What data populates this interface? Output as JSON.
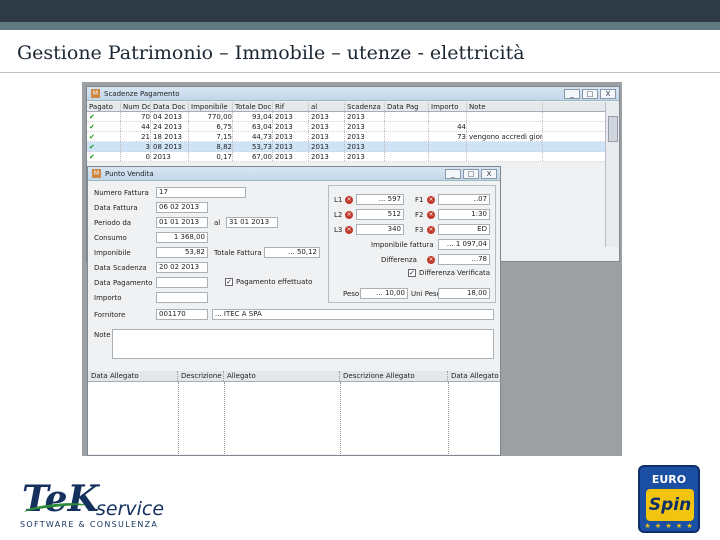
{
  "slide": {
    "title": "Gestione Patrimonio – Immobile – utenze - elettricità"
  },
  "back_window": {
    "title": "Scadenze Pagamento",
    "app_icon": "app-icon",
    "controls": [
      "_",
      "□",
      "X"
    ],
    "columns": [
      "Pagato",
      "Num Doc",
      "Data Doc",
      "Imponibile",
      "Totale Doc",
      "Rif",
      "al",
      "Scadenza",
      "Data Pag",
      "Importo",
      "Note"
    ],
    "rows": [
      {
        "paid": true,
        "num": "70",
        "day": "04",
        "year": "2013",
        "imp": "770,00",
        "tot": "93,04",
        "rif": "2013",
        "al": "2013",
        "scad": "2013",
        "imp2": "",
        "note": ""
      },
      {
        "paid": true,
        "num": "44",
        "day": "24",
        "year": "2013",
        "imp": "6,75",
        "tot": "63,04",
        "rif": "2013",
        "al": "2013",
        "scad": "2013",
        "imp2": "44",
        "note": ""
      },
      {
        "paid": true,
        "num": "21",
        "day": "18",
        "year": "2013",
        "imp": "7,15",
        "tot": "44,73",
        "rif": "2013",
        "al": "2013",
        "scad": "2013",
        "imp2": "73",
        "note": "vengono accredi gior"
      },
      {
        "paid": true,
        "num": "3",
        "day": "08",
        "year": "2013",
        "imp": "8,82",
        "tot": "53,73",
        "rif": "2013",
        "al": "2013",
        "scad": "2013",
        "imp2": "",
        "note": ""
      },
      {
        "paid": true,
        "num": "0",
        "day": "",
        "year": "2013",
        "imp": "0,17",
        "tot": "67,00",
        "rif": "2013",
        "al": "2013",
        "scad": "2013",
        "imp2": "",
        "note": ""
      }
    ]
  },
  "front_window": {
    "title": "Punto Vendita",
    "controls": [
      "_",
      "□",
      "X"
    ],
    "fields": {
      "numero_fattura_label": "Numero Fattura",
      "numero_fattura": "17",
      "data_fattura_label": "Data Fattura",
      "data_fattura": "06 02 2013",
      "periodo_label": "Periodo da",
      "periodo_da": "01 01 2013",
      "al_label": "al",
      "periodo_al": "31 01 2013",
      "consumo_label": "Consumo",
      "consumo": "1 368,00",
      "imponibile_label": "Imponibile",
      "imponibile": "53,82",
      "totale_fattura_label": "Totale Fattura",
      "totale_fattura": "... 50,12",
      "data_scadenza_label": "Data Scadenza",
      "data_scadenza": "20 02 2013",
      "pagamento_effettuato_label": "Pagamento effettuato",
      "pagamento_effettuato": true,
      "data_pagamento_label": "Data Pagamento",
      "data_pagamento": "",
      "importo_label": "Importo",
      "importo": "",
      "fornitore_label": "Fornitore",
      "fornitore_code": "001170",
      "fornitore_name": "... ITEC A SPA",
      "note_label": "Note"
    },
    "meter": {
      "l1_label": "L1",
      "l1_value": "... 597",
      "l2_label": "L2",
      "l2_value": "512",
      "l3_label": "L3",
      "l3_value": "340",
      "f1_label": "F1",
      "f1_value": "..07",
      "f2_label": "F2",
      "f2_value": "1:30",
      "f3_label": "F3",
      "f3_value": "ED",
      "importo_fattura_label": "Imponibile fattura",
      "importo_fattura": "... 1 097,04",
      "differenza_label": "Differenza",
      "differenza": "...78",
      "differenza_verificata_label": "Differenza Verificata",
      "differenza_verificata": true,
      "peso_label": "Peso",
      "peso": "... 10,00",
      "uni_peso_label": "Uni Peso",
      "uni_peso": "18,00"
    },
    "attachments_columns": [
      "Data Allegato",
      "Descrizione",
      "Allegato",
      "Descrizione Allegato",
      "Data Allegato"
    ]
  },
  "logos": {
    "tek_main": "TeK",
    "tek_service": "service",
    "tek_sub": "SOFTWARE & CONSULENZA",
    "euro_top": "EURO",
    "euro_spin": "Spin",
    "euro_stars": "★ ★ ★ ★ ★"
  },
  "colors": {
    "title_text": "#1b2733",
    "header_dark": "#2e3a44",
    "header_accent": "#5f7a80",
    "check_green": "#1a9a1a",
    "delete_red": "#c0392b",
    "tek_blue": "#14315e",
    "euro_blue": "#1b4fa3",
    "euro_yellow": "#f2c40f"
  }
}
